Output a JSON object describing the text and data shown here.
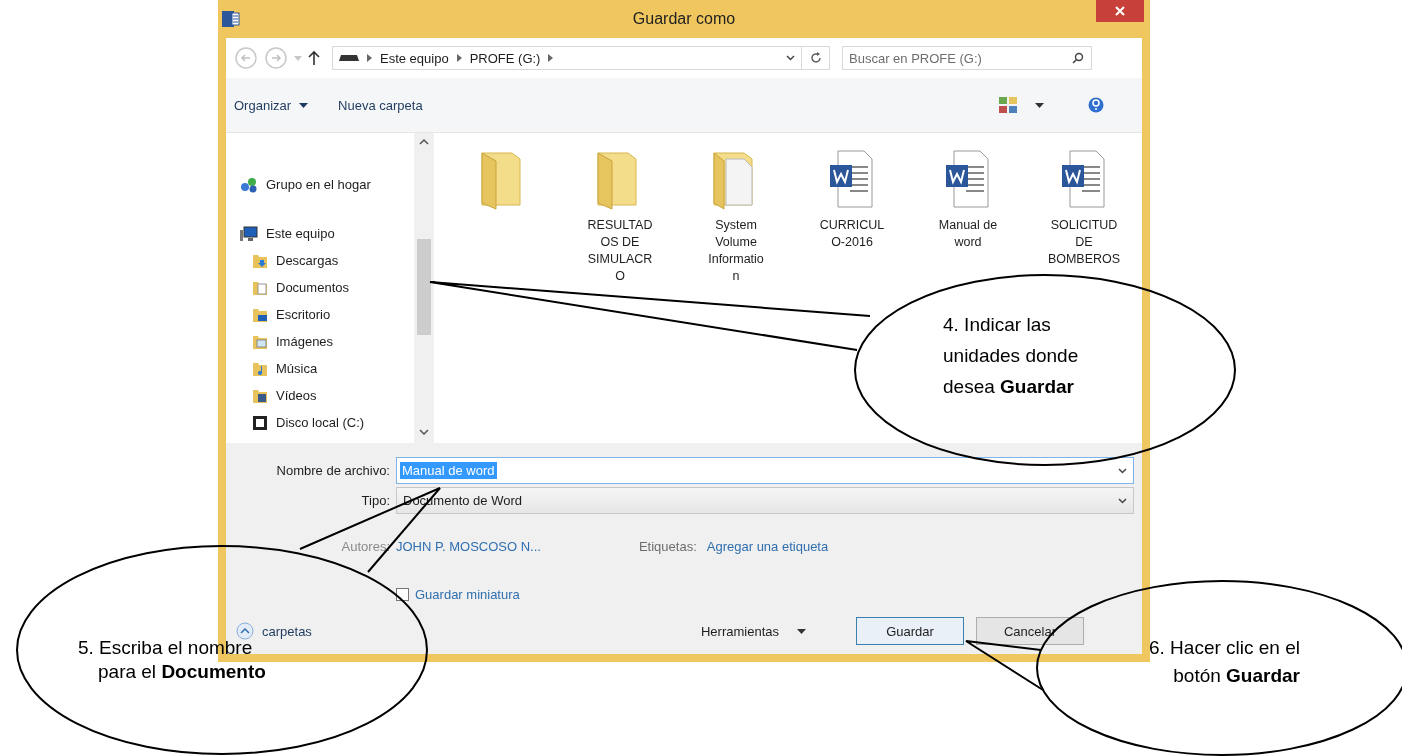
{
  "window": {
    "title": "Guardar como"
  },
  "address_bar": {
    "crumbs": [
      "Este equipo",
      "PROFE (G:)"
    ]
  },
  "search": {
    "placeholder": "Buscar en PROFE (G:)"
  },
  "toolbar": {
    "organize": "Organizar",
    "new_folder": "Nueva carpeta"
  },
  "sidebar": {
    "items": [
      {
        "label": "Grupo en el hogar",
        "kind": "homegroup"
      },
      {
        "label": "Este equipo",
        "kind": "computer",
        "children": [
          {
            "label": "Descargas",
            "kind": "downloads"
          },
          {
            "label": "Documentos",
            "kind": "documents"
          },
          {
            "label": "Escritorio",
            "kind": "desktop"
          },
          {
            "label": "Imágenes",
            "kind": "pictures"
          },
          {
            "label": "Música",
            "kind": "music"
          },
          {
            "label": "Vídeos",
            "kind": "videos"
          },
          {
            "label": "Disco local (C:)",
            "kind": "drive"
          }
        ]
      }
    ]
  },
  "files": [
    {
      "kind": "folder"
    },
    {
      "kind": "folder",
      "name": "RESULTAD\nOS DE\nSIMULACR\nO"
    },
    {
      "kind": "system_folder",
      "name": "System\nVolume\nInformatio\nn"
    },
    {
      "kind": "document",
      "name": "CURRICUL\nO-2016"
    },
    {
      "kind": "document",
      "name": "Manual de\nword"
    },
    {
      "kind": "document",
      "name": "SOLICITUD\nDE\nBOMBEROS"
    }
  ],
  "filename": {
    "label": "Nombre de archivo:",
    "value": "Manual de word",
    "selected": true
  },
  "type": {
    "label": "Tipo:",
    "value": "Documento de Word"
  },
  "authors": {
    "label": "Autores:",
    "value": "JOHN P. MOSCOSO N..."
  },
  "tags": {
    "label": "Etiquetas:",
    "value": "Agregar una etiqueta"
  },
  "thumbnail": {
    "label": "Guardar miniatura",
    "checked": false
  },
  "hide_folders": {
    "label": "carpetas"
  },
  "tools": {
    "label": "Herramientas"
  },
  "buttons": [
    {
      "label": "Guardar",
      "focused": true
    },
    {
      "label": "Cancelar",
      "focused": false
    }
  ],
  "callouts": [
    {
      "text": "4.  Indicar las\nunidades donde\ndesea **Guardar**"
    },
    {
      "text": "5.  Escriba el nombre\npara el **Documento**"
    },
    {
      "text": "6.  Hacer clic en el\nbotón **Guardar**"
    }
  ]
}
